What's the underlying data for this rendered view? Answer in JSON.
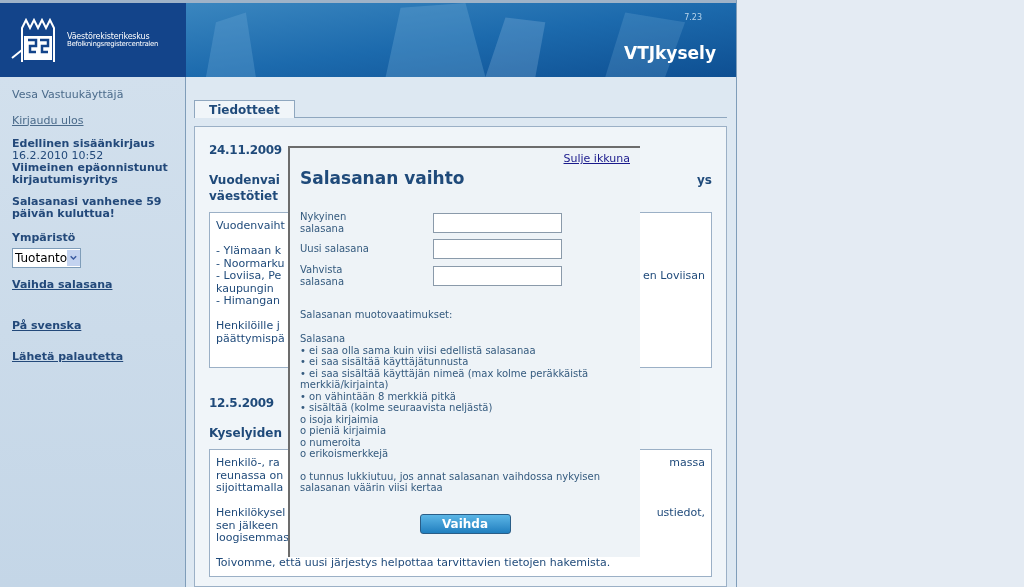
{
  "header": {
    "org_name": "Väestörekisterikeskus",
    "org_name_sv": "Befolkningsregistercentralen",
    "version": "7.23",
    "app_title": "VTJkysely"
  },
  "sidebar": {
    "user": "Vesa Vastuukäyttäjä",
    "logout": "Kirjaudu ulos",
    "last_login_label": "Edellinen sisäänkirjaus",
    "last_login_time": "16.2.2010 10:52",
    "failed_login_label": "Viimeinen epäonnistunut kirjautumisyritys",
    "expiry_notice": "Salasanasi vanhenee 59 päivän kuluttua!",
    "environment_label": "Ympäristö",
    "environment_value": "Tuotanto",
    "links": [
      {
        "label": "Vaihda salasana"
      },
      {
        "label": "På svenska"
      },
      {
        "label": "Lähetä palautetta"
      }
    ]
  },
  "tabs": [
    {
      "label": "Tiedotteet",
      "selected": true
    }
  ],
  "news": [
    {
      "date": "24.11.2009",
      "heading": [
        {
          "left": "Vuodenvai",
          "right": "ys"
        },
        {
          "left": "väestötiet"
        }
      ],
      "paragraphs": [
        [
          {
            "left": "Vuodenvaiht"
          }
        ],
        [
          {
            "left": "- Ylämaan k"
          },
          {
            "left": "- Noormarku"
          },
          {
            "left": "- Loviisa, Pe",
            "right": "en Loviisan"
          },
          {
            "left": "kaupungin"
          },
          {
            "left": "- Himangan"
          }
        ],
        [
          {
            "left": "Henkilöille j"
          },
          {
            "left": "päättymispä"
          }
        ]
      ]
    },
    {
      "date": "12.5.2009",
      "heading": [
        {
          "left": "Kyselyiden"
        }
      ],
      "paragraphs": [
        [
          {
            "left": "Henkilö-, ra",
            "right": "massa"
          },
          {
            "left": "reunassa on"
          },
          {
            "left": "sijoittamalla"
          }
        ],
        [
          {
            "left": "Henkilökysel",
            "right": "ustiedot,"
          },
          {
            "left": "sen jälkeen"
          },
          {
            "left": "loogisemmas"
          }
        ],
        [
          {
            "left": "Toivomme, että uusi järjestys helpottaa tarvittavien tietojen hakemista."
          }
        ]
      ]
    }
  ],
  "dialog": {
    "close_link": "Sulje ikkuna",
    "title": "Salasanan vaihto",
    "fields": [
      {
        "label": "Nykyinen salasana"
      },
      {
        "label": "Uusi salasana"
      },
      {
        "label": "Vahvista salasana"
      }
    ],
    "requirements_title": "Salasanan muotovaatimukset:",
    "requirements": [
      "Salasana",
      "• ei saa olla sama kuin viisi edellistä salasanaa",
      "• ei saa sisältää käyttäjätunnusta",
      "• ei saa sisältää käyttäjän nimeä (max kolme peräkkäistä merkkiä/kirjainta)",
      "• on vähintään 8 merkkiä pitkä",
      "• sisältää (kolme seuraavista neljästä)",
      "o isoja kirjaimia",
      "o pieniä kirjaimia",
      "o numeroita",
      "o erikoismerkkejä"
    ],
    "lock_notice": "o tunnus lukkiutuu, jos annat salasanan vaihdossa nykyisen salasanan väärin viisi kertaa",
    "submit": "Vaihda"
  }
}
